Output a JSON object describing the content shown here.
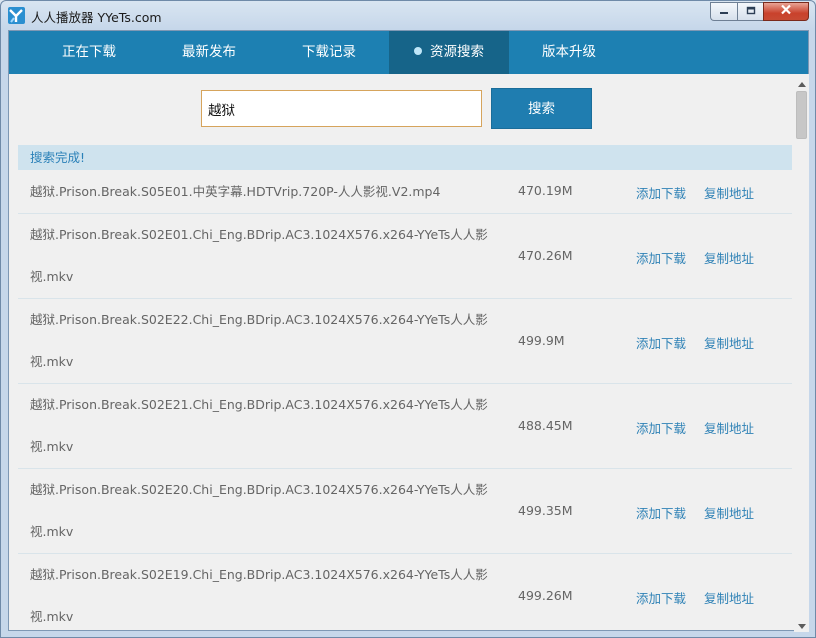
{
  "window": {
    "title": "人人播放器 YYeTs.com"
  },
  "colors": {
    "nav_bg": "#1d80b2",
    "nav_active": "#166489",
    "link": "#2f82b6",
    "status_bg": "#cfe3ee"
  },
  "tabs": [
    {
      "label": "正在下载",
      "active": false
    },
    {
      "label": "最新发布",
      "active": false
    },
    {
      "label": "下载记录",
      "active": false
    },
    {
      "label": "资源搜索",
      "active": true
    },
    {
      "label": "版本升级",
      "active": false
    }
  ],
  "search": {
    "value": "越狱",
    "button_label": "搜索"
  },
  "status": "搜索完成!",
  "results": [
    {
      "name": "越狱.Prison.Break.S05E01.中英字幕.HDTVrip.720P-人人影视.V2.mp4",
      "size": "470.19M",
      "add_label": "添加下载",
      "copy_label": "复制地址"
    },
    {
      "name": "越狱.Prison.Break.S02E01.Chi_Eng.BDrip.AC3.1024X576.x264-YYeTs人人影视.mkv",
      "size": "470.26M",
      "add_label": "添加下载",
      "copy_label": "复制地址"
    },
    {
      "name": "越狱.Prison.Break.S02E22.Chi_Eng.BDrip.AC3.1024X576.x264-YYeTs人人影视.mkv",
      "size": "499.9M",
      "add_label": "添加下载",
      "copy_label": "复制地址"
    },
    {
      "name": "越狱.Prison.Break.S02E21.Chi_Eng.BDrip.AC3.1024X576.x264-YYeTs人人影视.mkv",
      "size": "488.45M",
      "add_label": "添加下载",
      "copy_label": "复制地址"
    },
    {
      "name": "越狱.Prison.Break.S02E20.Chi_Eng.BDrip.AC3.1024X576.x264-YYeTs人人影视.mkv",
      "size": "499.35M",
      "add_label": "添加下载",
      "copy_label": "复制地址"
    },
    {
      "name": "越狱.Prison.Break.S02E19.Chi_Eng.BDrip.AC3.1024X576.x264-YYeTs人人影视.mkv",
      "size": "499.26M",
      "add_label": "添加下载",
      "copy_label": "复制地址"
    }
  ],
  "icons": {
    "app": "yyets-logo-icon",
    "minimize": "minimize-icon",
    "maximize": "maximize-icon",
    "close": "close-icon",
    "scroll_up": "scroll-up-arrow-icon",
    "scroll_down": "scroll-down-arrow-icon"
  }
}
